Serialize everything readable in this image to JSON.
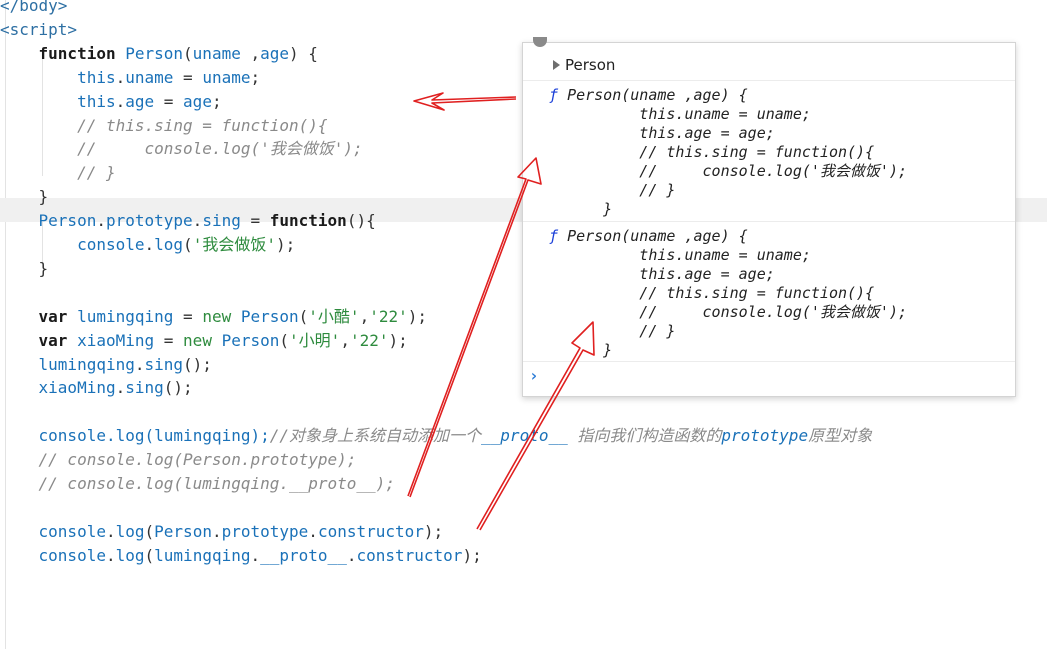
{
  "editor": {
    "lines": [
      [
        "</body>"
      ],
      [
        "<script>"
      ],
      [
        "    function Person(uname ,age) {"
      ],
      [
        "        this.uname = uname;"
      ],
      [
        "        this.age = age;"
      ],
      [
        "        // this.sing = function(){"
      ],
      [
        "        //     console.log('我会做饭');"
      ],
      [
        "        // }"
      ],
      [
        "    }"
      ],
      [
        "    Person.prototype.sing = function(){"
      ],
      [
        "        console.log('我会做饭');"
      ],
      [
        "    }"
      ],
      [
        ""
      ],
      [
        "    var lumingqing = new Person('小酷','22');"
      ],
      [
        "    var xiaoMing = new Person('小明','22');"
      ],
      [
        "    lumingqing.sing();"
      ],
      [
        "    xiaoMing.sing();"
      ],
      [
        ""
      ],
      [
        "    console.log(lumingqing);//对象身上系统自动添加一个__proto__ 指向我们构造函数的prototype原型对象"
      ],
      [
        "    // console.log(Person.prototype);"
      ],
      [
        "    // console.log(lumingqing.__proto__);"
      ],
      [
        ""
      ],
      [
        "    console.log(Person.prototype.constructor);"
      ],
      [
        "    console.log(lumingqing.__proto__.constructor);"
      ]
    ]
  },
  "console": {
    "object_label": "Person",
    "func_marker": "ƒ",
    "output1": [
      "Person(uname ,age) {",
      "        this.uname = uname;",
      "        this.age = age;",
      "        // this.sing = function(){",
      "        //     console.log('我会做饭');",
      "        // }",
      "    }"
    ],
    "output2": [
      "Person(uname ,age) {",
      "        this.uname = uname;",
      "        this.age = age;",
      "        // this.sing = function(){",
      "        //     console.log('我会做饭');",
      "        // }",
      "    }"
    ],
    "prompt": "›"
  },
  "colors": {
    "annotation_arrow": "#e02020",
    "keyword": "#1b1b1b",
    "identifier": "#1a71b8",
    "string": "#2e8b3e",
    "comment": "#8a8a8a"
  }
}
